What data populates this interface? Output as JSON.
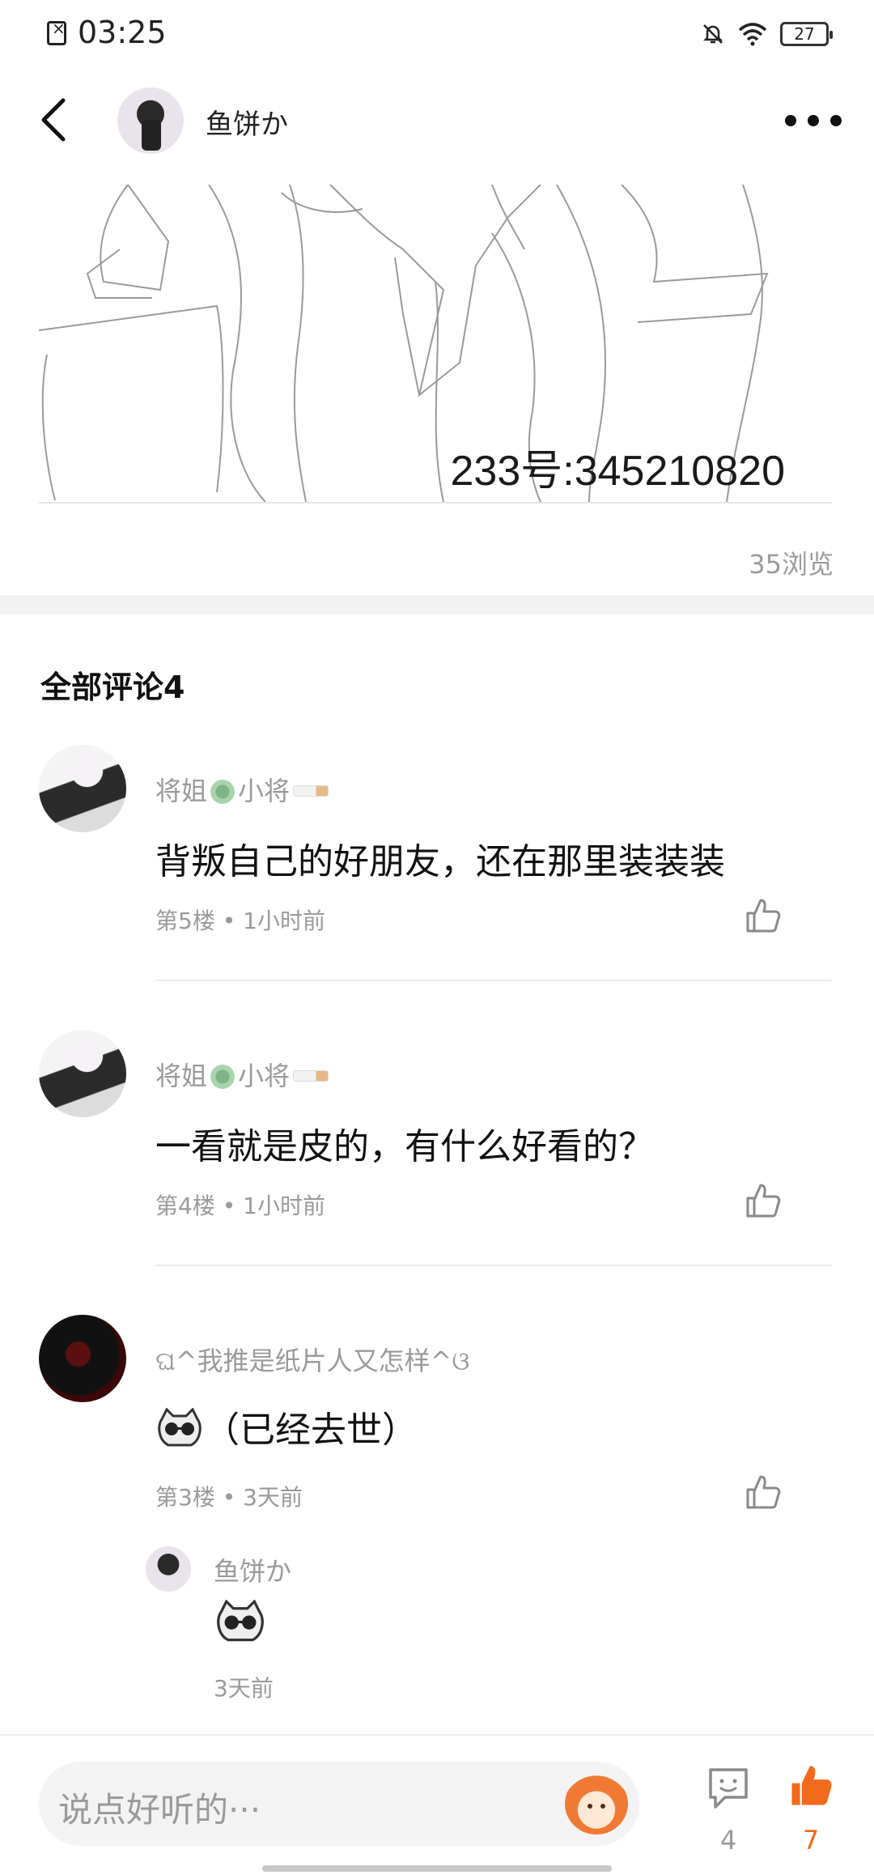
{
  "status_bar": {
    "time": "03:25",
    "battery": "27",
    "icons": [
      "sim-error-icon",
      "bell-off-icon",
      "wifi-icon",
      "battery-icon"
    ]
  },
  "header": {
    "author_name": "鱼饼か",
    "icons": [
      "back-arrow-icon",
      "more-dots-icon"
    ]
  },
  "post": {
    "image_caption": "233号:345210820",
    "views": "35浏览"
  },
  "comments_section": {
    "title": "全部评论4",
    "comments": [
      {
        "username": "将姐",
        "username_suffix": "小将",
        "text": "背叛自己的好朋友，还在那里装装装",
        "meta": "第5楼 • 1小时前"
      },
      {
        "username": "将姐",
        "username_suffix": "小将",
        "text": "一看就是皮的，有什么好看的？",
        "meta": "第4楼 • 1小时前"
      },
      {
        "username": "ଘ^我推是纸片人又怎样^ଓ",
        "text": "（已经去世）",
        "meta": "第3楼 • 3天前",
        "reply": {
          "username": "鱼饼か",
          "time": "3天前"
        }
      }
    ]
  },
  "bottom_bar": {
    "input_placeholder": "说点好听的···",
    "comment_count": "4",
    "like_count": "7",
    "accent_color": "#f26a1b"
  }
}
